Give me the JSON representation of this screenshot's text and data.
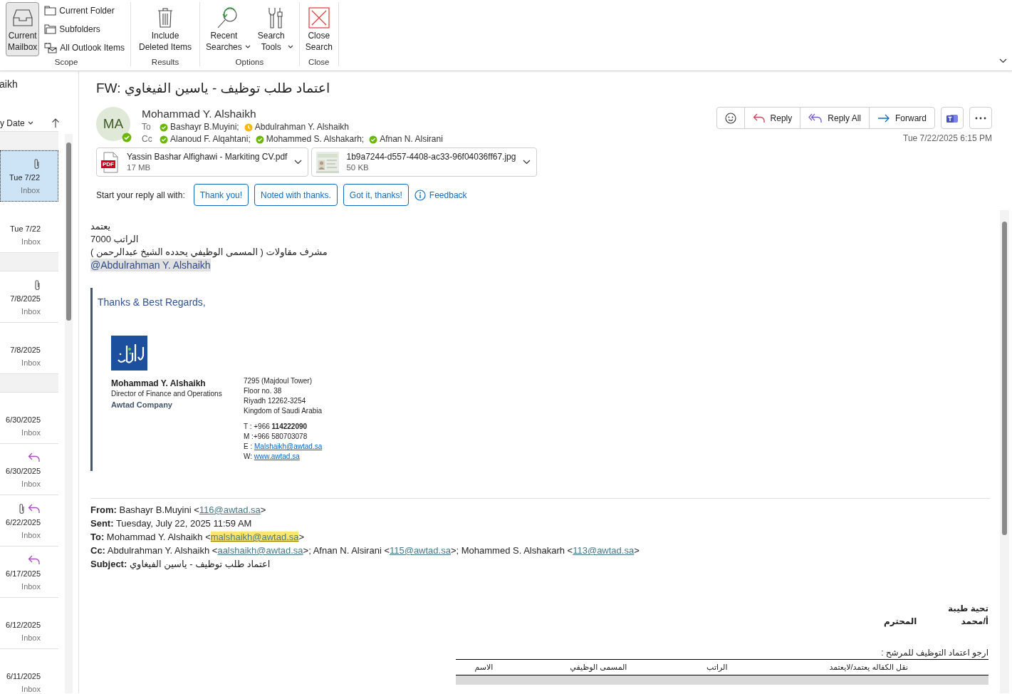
{
  "ribbon": {
    "groups": [
      {
        "label": "Scope",
        "buttons": [
          {
            "label": "Current Mailbox",
            "kind": "large",
            "selected": true
          },
          {
            "label": "Current Folder",
            "kind": "small",
            "selected": false
          },
          {
            "label": "Subfolders",
            "kind": "small",
            "selected": false
          },
          {
            "label": "All Outlook Items",
            "kind": "small",
            "selected": false
          }
        ]
      },
      {
        "label": "Results",
        "buttons": [
          {
            "label": "Include Deleted Items",
            "kind": "large"
          }
        ]
      },
      {
        "label": "Options",
        "buttons": [
          {
            "label": "Recent Searches",
            "kind": "large",
            "dropdown": true
          },
          {
            "label": "Search Tools",
            "kind": "large",
            "dropdown": true
          }
        ]
      },
      {
        "label": "Close",
        "buttons": [
          {
            "label": "Close Search",
            "kind": "large"
          }
        ]
      }
    ]
  },
  "message_list": {
    "title": "aikh",
    "sort": "y Date",
    "items": [
      {
        "kind": "group"
      },
      {
        "kind": "message",
        "date": "Tue 7/22",
        "folder": "Inbox",
        "selected": true,
        "attachment": true,
        "replied": false
      },
      {
        "kind": "message",
        "date": "Tue 7/22",
        "folder": "Inbox",
        "selected": false,
        "attachment": false,
        "replied": false
      },
      {
        "kind": "group"
      },
      {
        "kind": "message",
        "date": "7/8/2025",
        "folder": "Inbox",
        "selected": false,
        "attachment": true,
        "replied": false
      },
      {
        "kind": "message",
        "date": "7/8/2025",
        "folder": "Inbox",
        "selected": false,
        "attachment": false,
        "replied": false
      },
      {
        "kind": "group"
      },
      {
        "kind": "message",
        "date": "6/30/2025",
        "folder": "Inbox",
        "selected": false,
        "attachment": false,
        "replied": false
      },
      {
        "kind": "message",
        "date": "6/30/2025",
        "folder": "Inbox",
        "selected": false,
        "attachment": false,
        "replied": true
      },
      {
        "kind": "message",
        "date": "6/22/2025",
        "folder": "Inbox",
        "selected": false,
        "attachment": true,
        "replied": true
      },
      {
        "kind": "message",
        "date": "6/17/2025",
        "folder": "Inbox",
        "selected": false,
        "attachment": false,
        "replied": true
      },
      {
        "kind": "message",
        "date": "6/12/2025",
        "folder": "Inbox",
        "selected": false,
        "attachment": false,
        "replied": false
      },
      {
        "kind": "message",
        "date": "6/11/2025",
        "folder": "Inbox",
        "selected": false,
        "attachment": false,
        "replied": false
      }
    ]
  },
  "message": {
    "subject": "FW: اعتماد طلب توظيف - ياسين  الفيغاوي",
    "initials": "MA",
    "sender_available": true,
    "sender": "Mohammad Y. Alshaikh",
    "to_label": "To",
    "to": [
      {
        "name": "Bashayr B.Muyini;",
        "away": false
      },
      {
        "name": "Abdulrahman Y. Alshaikh",
        "away": true
      }
    ],
    "cc_label": "Cc",
    "cc": [
      {
        "name": "Alanoud F. Alqahtani;",
        "away": false
      },
      {
        "name": "Mohammed S. Alshakarh;",
        "away": false
      },
      {
        "name": "Afnan N. Alsirani",
        "away": false
      }
    ],
    "actions": [
      "Reply",
      "Reply All",
      "Forward"
    ],
    "date": "Tue 7/22/2025 6:15 PM",
    "attachments": [
      {
        "kind": "pdf",
        "badge": "PDF",
        "name": "Yassin Bashar Alfighawi - Markiting CV.pdf",
        "size": "17 MB"
      },
      {
        "name": "1b9a7244-d557-4408-ac33-96f04036ff67.jpg",
        "size": "50 KB"
      }
    ],
    "reply_prompt": "Start your reply all with:",
    "suggestions": [
      "Thank you!",
      "Noted with thanks.",
      "Got it, thanks!"
    ],
    "feedback": "Feedback"
  },
  "body": {
    "lines": [
      "يعتمد",
      "الراتب 7000",
      "مشرف مقاولات ( المسمى الوظيفي يحدده الشيخ عبدالرحمن )"
    ],
    "mention": "@Abdulrahman Y. Alshaikh",
    "signature": {
      "closing": "Thanks & Best Regards,",
      "name": "Mohammad Y. Alshaikh",
      "title": "Director of Finance and Operations",
      "company": "Awtad Company",
      "address": [
        "7295 (Majdoul Tower)",
        "Floor no. 38",
        "Riyadh 12262-3254",
        "Kingdom of Saudi Arabia"
      ],
      "contacts": [
        {
          "kind": "text",
          "text": "T : +966  **114222090**"
        },
        {
          "kind": "text",
          "text": "M :+966 580703078"
        },
        {
          "kind": "link",
          "label": "E : ",
          "link": "Malshaikh@awtad.sa"
        },
        {
          "kind": "link",
          "label": "W: ",
          "link": "www.awtad.sa"
        }
      ]
    },
    "forwarded": [
      {
        "label": "From:",
        "parts": [
          {
            "kind": "text",
            "text": " Bashayr B.Muyini <"
          },
          {
            "kind": "link",
            "text": "116@awtad.sa",
            "highlighted": false
          },
          {
            "kind": "text",
            "text": ">"
          }
        ]
      },
      {
        "label": "Sent:",
        "parts": [
          {
            "kind": "text",
            "text": " Tuesday, July 22, 2025 11:59 AM"
          }
        ]
      },
      {
        "label": "To:",
        "parts": [
          {
            "kind": "text",
            "text": " Mohammad Y. Alshaikh <"
          },
          {
            "kind": "link",
            "text": "malshaikh@awtad.sa",
            "highlighted": true
          },
          {
            "kind": "text",
            "text": ">"
          }
        ]
      },
      {
        "label": "Cc:",
        "parts": [
          {
            "kind": "text",
            "text": " Abdulrahman Y. Alshaikh <"
          },
          {
            "kind": "link",
            "text": "aalshaikh@awtad.sa",
            "highlighted": false
          },
          {
            "kind": "text",
            "text": ">; Afnan N. Alsirani <"
          },
          {
            "kind": "link",
            "text": "115@awtad.sa",
            "highlighted": false
          },
          {
            "kind": "text",
            "text": ">; Mohammed S. Alshakarh <"
          },
          {
            "kind": "link",
            "text": "113@awtad.sa",
            "highlighted": false
          },
          {
            "kind": "text",
            "text": ">"
          }
        ]
      },
      {
        "label": "Subject:",
        "parts": [
          {
            "kind": "text",
            "text": "  اعتماد طلب توظيف - ياسين الفيغاوي"
          }
        ]
      }
    ],
    "letter": {
      "greeting": "تحية طيبة",
      "addressee": "أ/محمد",
      "honorific": "المحترم",
      "request": "ارجو اعتماد التوظيف للمرشح :",
      "table": {
        "columns": [
          "نقل الكفاله يعتمد/لايعتمد",
          "الراتب",
          "المسمى الوظيفي",
          "الاسم"
        ]
      }
    }
  }
}
